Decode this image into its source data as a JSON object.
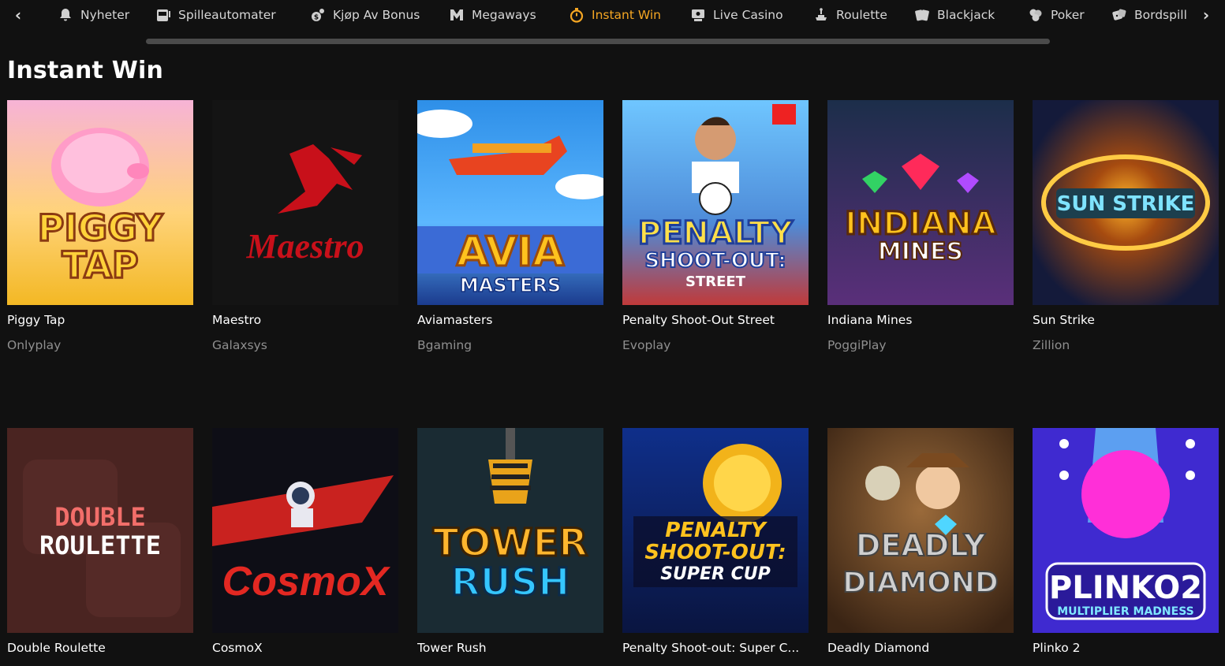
{
  "nav": {
    "items": [
      {
        "label": "Nyheter",
        "icon": "bell-icon",
        "active": false
      },
      {
        "label": "Spilleautomater",
        "icon": "slot-machine-icon",
        "active": false
      },
      {
        "label": "Kjøp Av Bonus",
        "icon": "bonus-buy-icon",
        "active": false
      },
      {
        "label": "Megaways",
        "icon": "megaways-icon",
        "active": false
      },
      {
        "label": "Instant Win",
        "icon": "stopwatch-icon",
        "active": true
      },
      {
        "label": "Live Casino",
        "icon": "live-casino-icon",
        "active": false
      },
      {
        "label": "Roulette",
        "icon": "roulette-icon",
        "active": false
      },
      {
        "label": "Blackjack",
        "icon": "cards-icon",
        "active": false
      },
      {
        "label": "Poker",
        "icon": "poker-chips-icon",
        "active": false
      },
      {
        "label": "Bordspill",
        "icon": "dice-icon",
        "active": false
      }
    ],
    "active_color": "#f5a623"
  },
  "section": {
    "title": "Instant Win"
  },
  "games": [
    {
      "name": "Piggy Tap",
      "provider": "Onlyplay",
      "art_text": "PIGGY TAP"
    },
    {
      "name": "Maestro",
      "provider": "Galaxsys",
      "art_text": "Maestro"
    },
    {
      "name": "Aviamasters",
      "provider": "Bgaming",
      "art_text": "AVIA",
      "art_sub": "MASTERS"
    },
    {
      "name": "Penalty Shoot-Out Street",
      "provider": "Evoplay",
      "art_text": "PENALTY",
      "art_sub": "SHOOT-OUT: STREET"
    },
    {
      "name": "Indiana Mines",
      "provider": "PoggiPlay",
      "art_text": "INDIANA",
      "art_sub": "MINES"
    },
    {
      "name": "Sun Strike",
      "provider": "Zillion",
      "art_text": "SUN STRIKE"
    },
    {
      "name": "Double Roulette",
      "provider": "",
      "art_text": "DOUBLE",
      "art_sub": "ROULETTE"
    },
    {
      "name": "CosmoX",
      "provider": "",
      "art_text": "CosmoX"
    },
    {
      "name": "Tower Rush",
      "provider": "",
      "art_text": "TOWER",
      "art_sub": "RUSH"
    },
    {
      "name": "Penalty Shoot-out: Super C...",
      "provider": "",
      "art_text": "PENALTY",
      "art_sub": "SHOOT-OUT:",
      "art_sub2": "SUPER CUP"
    },
    {
      "name": "Deadly Diamond",
      "provider": "",
      "art_text": "DEADLY",
      "art_sub": "DIAMOND"
    },
    {
      "name": "Plinko 2",
      "provider": "",
      "art_text": "PLINKO2",
      "art_sub": "MULTIPLIER MADNESS"
    }
  ]
}
